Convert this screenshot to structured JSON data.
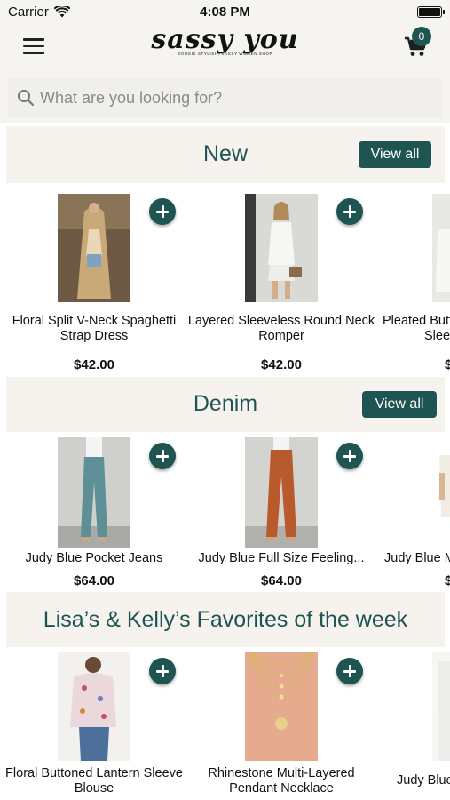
{
  "status_bar": {
    "carrier": "Carrier",
    "time": "4:08 PM"
  },
  "header": {
    "logo_text": "sassy you",
    "logo_tagline": "BOUGIE STYLISH, SASSY WOMEN SHOP",
    "cart_count": "0"
  },
  "search": {
    "placeholder": "What are you looking for?"
  },
  "sections": [
    {
      "title": "New",
      "view_all_label": "View all",
      "products": [
        {
          "name": "Floral Split V-Neck Spaghetti Strap Dress",
          "price": "$42.00"
        },
        {
          "name": "Layered Sleeveless Round Neck Romper",
          "price": "$42.00"
        },
        {
          "name": "Pleated Butt",
          "name_line2": "Slee",
          "price": "$"
        }
      ]
    },
    {
      "title": "Denim",
      "view_all_label": "View all",
      "products": [
        {
          "name": "Judy Blue  Pocket Jeans",
          "price": "$64.00"
        },
        {
          "name": "Judy Blue Full Size Feeling...",
          "price": "$64.00"
        },
        {
          "name": "Judy Blue M",
          "price": "$"
        }
      ]
    },
    {
      "title": "Lisa’s & Kelly’s Favorites of the week",
      "products": [
        {
          "name": "Floral Buttoned Lantern Sleeve Blouse"
        },
        {
          "name": "Rhinestone Multi-Layered Pendant Necklace"
        },
        {
          "name": "Judy Blue"
        }
      ]
    }
  ],
  "colors": {
    "accent": "#1e5452",
    "band": "#f6f3ef"
  }
}
